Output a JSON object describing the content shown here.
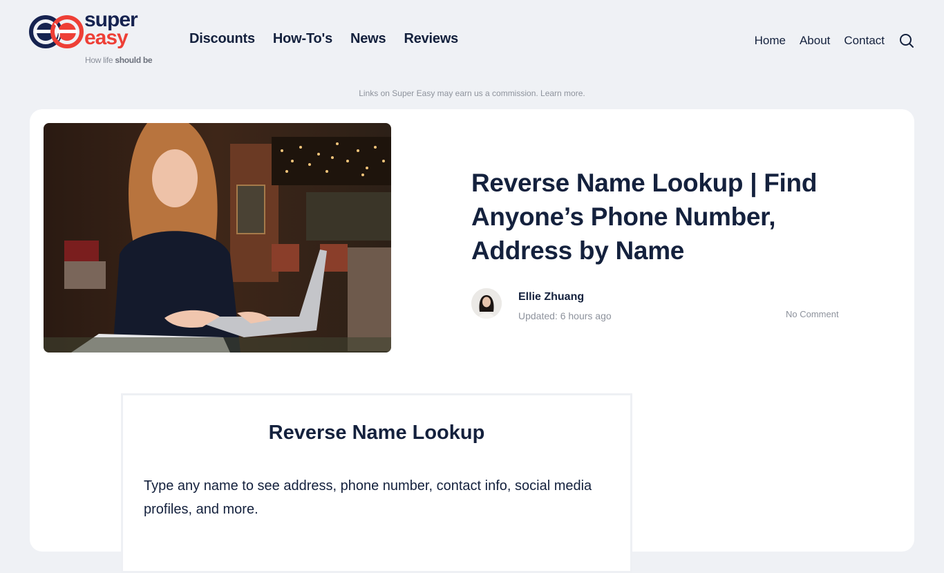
{
  "brand": {
    "word_top": "super",
    "word_bottom": "easy",
    "tagline_prefix": "How life ",
    "tagline_bold": "should be",
    "colors": {
      "navy": "#162350",
      "red": "#ee3f36"
    }
  },
  "main_nav": {
    "items": [
      {
        "label": "Discounts"
      },
      {
        "label": "How-To's"
      },
      {
        "label": "News"
      },
      {
        "label": "Reviews"
      }
    ]
  },
  "secondary_nav": {
    "items": [
      {
        "label": "Home"
      },
      {
        "label": "About"
      },
      {
        "label": "Contact"
      }
    ],
    "search_icon": "search-icon"
  },
  "disclosure": "Links on Super Easy may earn us a commission. Learn more.",
  "article": {
    "hero_image_alt": "Woman smiling at a laptop in a cafe, holding a phone",
    "title": "Reverse Name Lookup | Find Anyone’s Phone Number, Address by Name",
    "author": "Ellie Zhuang",
    "updated": "Updated: 6 hours ago",
    "comments": "No Comment"
  },
  "lookup_widget": {
    "title": "Reverse Name Lookup",
    "description": "Type any name to see address, phone number, contact info, social media profiles, and more."
  }
}
